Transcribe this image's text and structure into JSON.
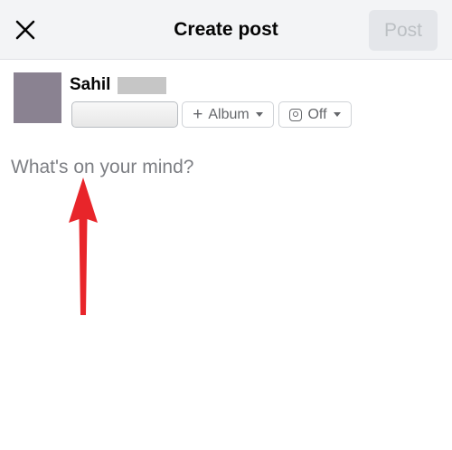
{
  "header": {
    "title": "Create post",
    "post_label": "Post",
    "close_icon": "close-icon"
  },
  "author": {
    "name": "Sahil"
  },
  "audience": {
    "album_label": "Album",
    "album_icon": "plus-icon",
    "instagram_label": "Off",
    "instagram_icon": "instagram-icon"
  },
  "composer": {
    "placeholder": "What's on your mind?",
    "value": ""
  },
  "annotation": {
    "arrow_color": "#e8252a",
    "arrow_icon": "red-arrow-up"
  },
  "colors": {
    "header_bg": "#f3f4f6",
    "post_button_bg": "#e4e6ea",
    "post_button_text": "#bcc0c4",
    "avatar": "#8a8291"
  }
}
